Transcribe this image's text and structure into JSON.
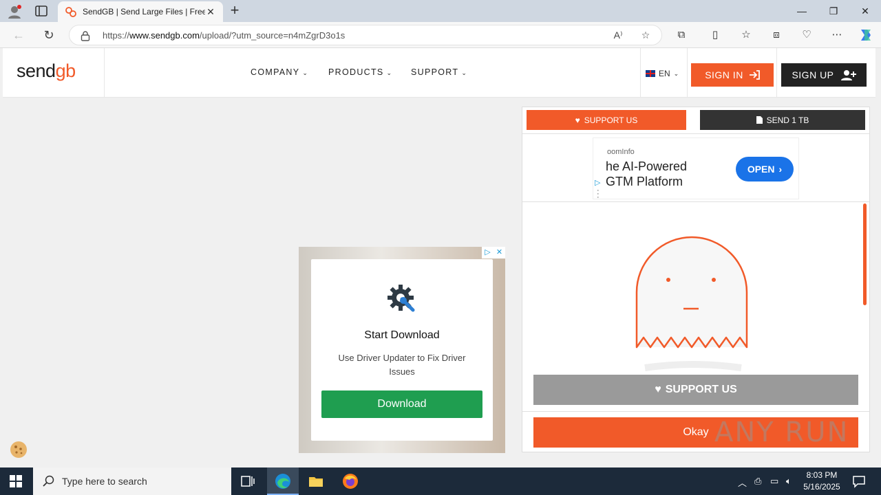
{
  "browser": {
    "tab_title": "SendGB | Send Large Files | Free f",
    "url_prefix": "https://",
    "url_domain": "www.sendgb.com",
    "url_rest": "/upload/?utm_source=n4mZgrD3o1s"
  },
  "header": {
    "logo_text_1": "send",
    "logo_text_2": "gb",
    "menu": [
      {
        "label": "COMPANY"
      },
      {
        "label": "PRODUCTS"
      },
      {
        "label": "SUPPORT"
      }
    ],
    "lang": "EN",
    "signin_label": "SIGN IN",
    "signup_label": "SIGN UP"
  },
  "panel": {
    "support_top_label": "SUPPORT US",
    "send1tb_label": "SEND 1 TB",
    "ad": {
      "brand": "oomInfo",
      "headline": "he AI-Powered GTM Platform",
      "open_label": "OPEN"
    },
    "support_gray_label": "SUPPORT US",
    "okay_label": "Okay"
  },
  "popup_ad": {
    "title": "Start Download",
    "description": "Use Driver Updater to Fix Driver Issues",
    "download_label": "Download"
  },
  "taskbar": {
    "search_placeholder": "Type here to search",
    "time": "8:03 PM",
    "date": "5/16/2025"
  },
  "watermark": "ANY RUN",
  "colors": {
    "brand_orange": "#f15a29",
    "dark": "#222222",
    "download_green": "#1f9e50",
    "ad_blue": "#1a73e8"
  }
}
